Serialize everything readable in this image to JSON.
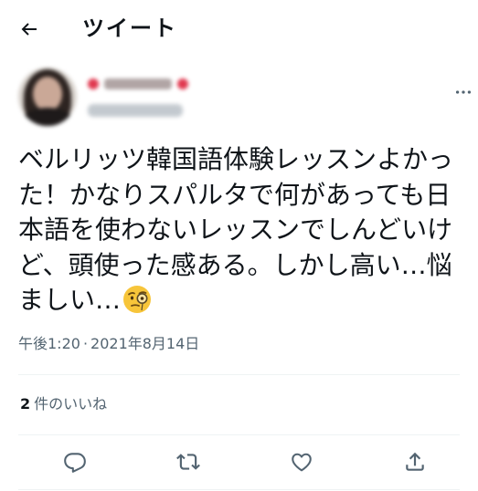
{
  "header": {
    "title": "ツイート",
    "back_icon": "arrow-left-icon"
  },
  "author": {
    "avatar": "user-avatar",
    "more_icon": "more-horizontal-icon"
  },
  "tweet": {
    "text": "ベルリッツ韓国語体験レッスンよかった！かなりスパルタで何があっても日本語を使わないレッスンでしんどいけど、頭使った感ある。しかし高い…悩ましい…",
    "emoji": "face-with-monocle-icon"
  },
  "meta": {
    "time": "午後1:20",
    "separator": "·",
    "date": "2021年8月14日"
  },
  "stats": {
    "like_count": "2",
    "like_label": "件のいいね"
  },
  "actions": {
    "reply_icon": "reply-icon",
    "retweet_icon": "retweet-icon",
    "like_icon": "heart-icon",
    "share_icon": "share-icon"
  },
  "colors": {
    "text": "#0f1419",
    "secondary": "#536471",
    "divider": "#eff3f4",
    "background": "#ffffff"
  }
}
